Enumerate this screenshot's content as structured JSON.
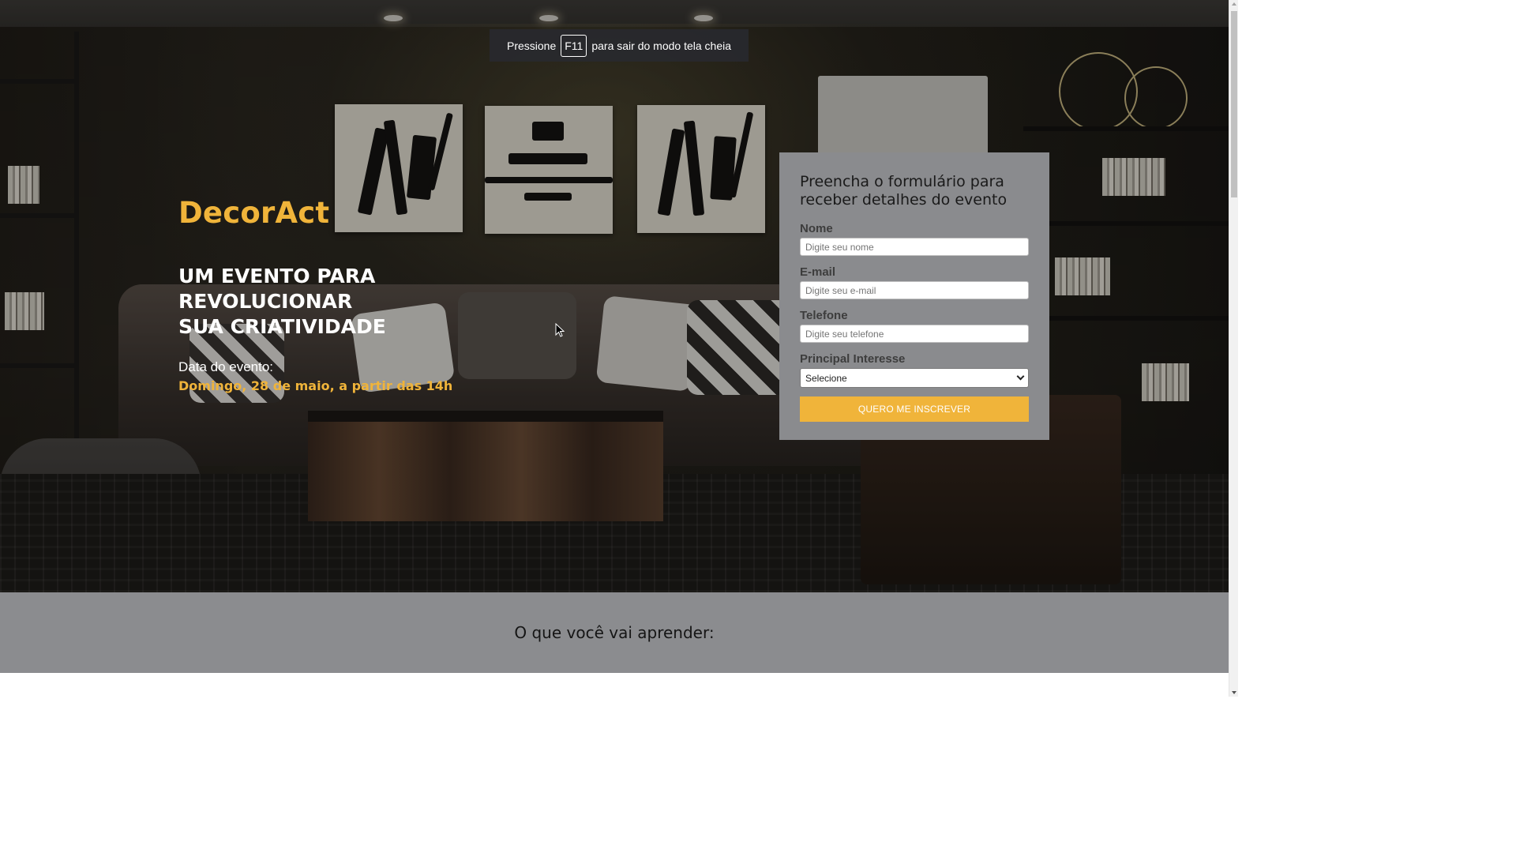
{
  "fullscreen_toast": {
    "prefix": "Pressione",
    "key": "F11",
    "suffix": "para sair do modo tela cheia"
  },
  "hero": {
    "brand": "DecorAct",
    "headline": [
      "UM EVENTO PARA",
      "REVOLUCIONAR",
      "SUA CRIATIVIDADE"
    ],
    "date_label": "Data do evento:",
    "date_value": "Domingo, 28 de maio, a partir das 14h",
    "background_image": "living-room-photo"
  },
  "form": {
    "title": "Preencha o formulário para receber detalhes do evento",
    "fields": {
      "name": {
        "label": "Nome",
        "placeholder": "Digite seu nome",
        "value": ""
      },
      "email": {
        "label": "E-mail",
        "placeholder": "Digite seu e-mail",
        "value": ""
      },
      "phone": {
        "label": "Telefone",
        "placeholder": "Digite seu telefone",
        "value": ""
      },
      "interest": {
        "label": "Principal Interesse",
        "selected": "Selecione"
      }
    },
    "submit_label": "QUERO ME INSCREVER"
  },
  "learn_section": {
    "title": "O que você vai aprender:"
  },
  "colors": {
    "accent": "#f0b43a",
    "form_bg": "#8a8b8e",
    "section_bg": "#8b8c8f",
    "toast_bg": "#28292d"
  }
}
